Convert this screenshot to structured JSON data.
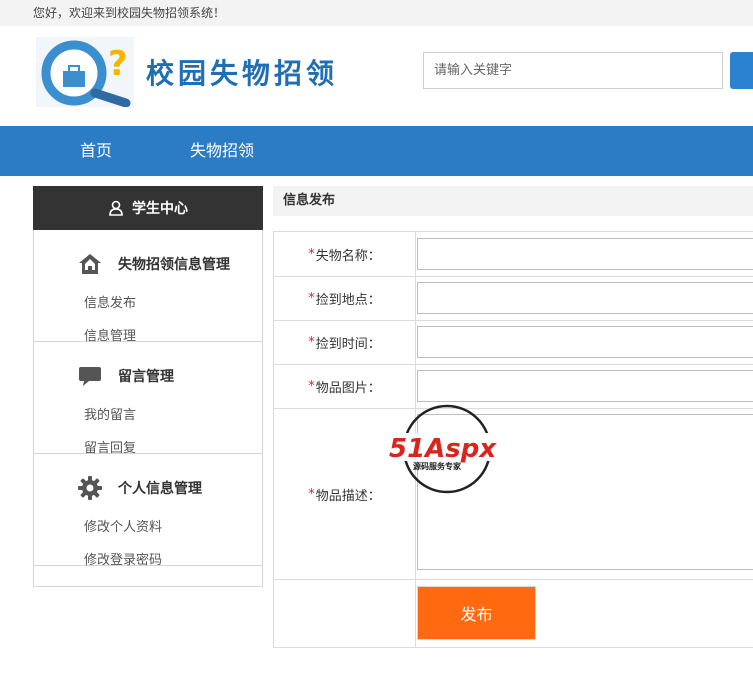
{
  "topbar": {
    "welcome": "您好，欢迎来到校园失物招领系统！"
  },
  "header": {
    "site_title": "校园失物招领",
    "search_placeholder": "请输入关键字"
  },
  "nav": {
    "items": [
      "首页",
      "失物招领"
    ]
  },
  "sidebar": {
    "header": "学生中心",
    "sections": [
      {
        "title": "失物招领信息管理",
        "icon": "home-icon",
        "links": [
          "信息发布",
          "信息管理"
        ]
      },
      {
        "title": "留言管理",
        "icon": "chat-bubble-icon",
        "links": [
          "我的留言",
          "留言回复"
        ]
      },
      {
        "title": "个人信息管理",
        "icon": "gear-icon",
        "links": [
          "修改个人资料",
          "修改登录密码"
        ]
      }
    ]
  },
  "content": {
    "title": "信息发布",
    "required_mark": "*",
    "fields": [
      "失物名称：",
      "捡到地点：",
      "捡到时间：",
      "物品图片：",
      "物品描述："
    ],
    "submit_label": "发布"
  },
  "watermark": {
    "brand": "51Aspx",
    "tagline": "源码服务专家"
  },
  "colors": {
    "nav_blue": "#2b7cc4",
    "submit_orange": "#ff6a10",
    "sidebar_dark": "#333333",
    "required_red": "#e02020"
  }
}
